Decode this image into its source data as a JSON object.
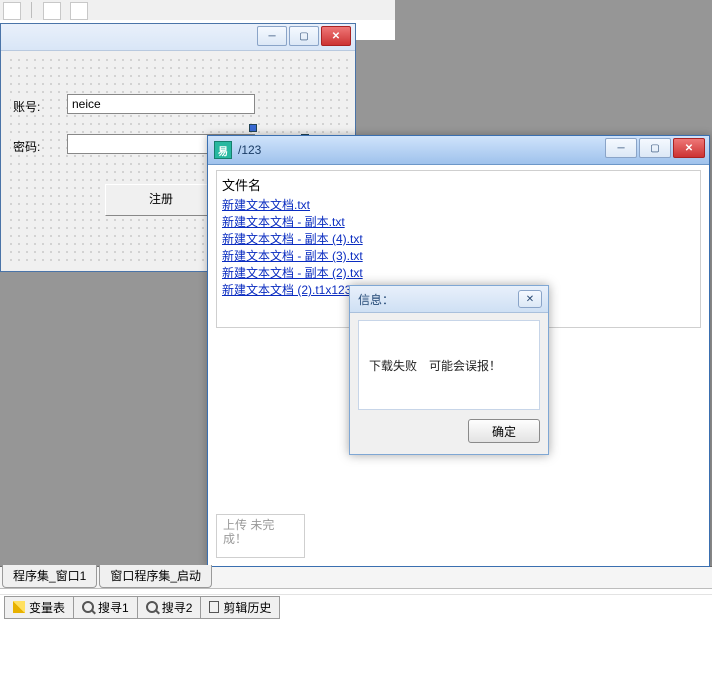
{
  "designForm": {
    "labels": {
      "account": "账号:",
      "password": "密码:"
    },
    "accountValue": "neice",
    "passwordValue": "",
    "registerBtn": "注册"
  },
  "runWindow": {
    "title": "/123",
    "appIconLetter": "易",
    "listHeader": "文件名",
    "files": [
      "新建文本文档.txt",
      "新建文本文档 - 副本.txt",
      "新建文本文档 - 副本 (4).txt",
      "新建文本文档 - 副本 (3).txt",
      "新建文本文档 - 副本 (2).txt",
      "新建文本文档 (2).t1x1231tadwadq123"
    ],
    "status": "上传 未完成！"
  },
  "messageBox": {
    "title": "信息：",
    "text": "下载失败　可能会误报！",
    "ok": "确定"
  },
  "tabs": {
    "docTabs": [
      "程序集_窗口1",
      "窗口程序集_启动"
    ],
    "toolTabs": [
      "变量表",
      "搜寻1",
      "搜寻2",
      "剪辑历史"
    ]
  }
}
